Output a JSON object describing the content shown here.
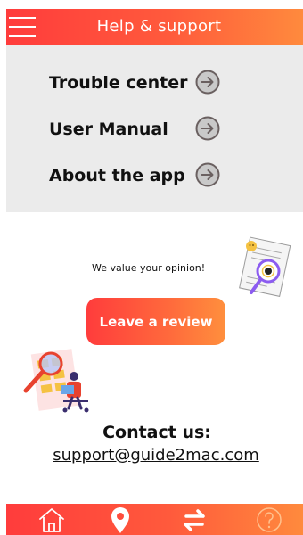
{
  "header": {
    "title": "Help & support"
  },
  "menu": {
    "items": [
      {
        "label": "Trouble center",
        "icon": "arrow-right-circle-icon"
      },
      {
        "label": "User Manual",
        "icon": "arrow-right-circle-icon"
      },
      {
        "label": "About the app",
        "icon": "arrow-right-circle-icon"
      }
    ]
  },
  "feedback": {
    "prompt": "We value your opinion!",
    "button_label": "Leave a review"
  },
  "contact": {
    "heading": "Contact us:",
    "email": "support@guide2mac.com"
  },
  "bottom_nav": {
    "items": [
      "home-icon",
      "location-pin-icon",
      "swap-arrows-icon",
      "help-icon"
    ]
  },
  "colors": {
    "accent_start": "#ff3c3c",
    "accent_end": "#ff8a3d",
    "panel_bg": "#ebebeb"
  }
}
